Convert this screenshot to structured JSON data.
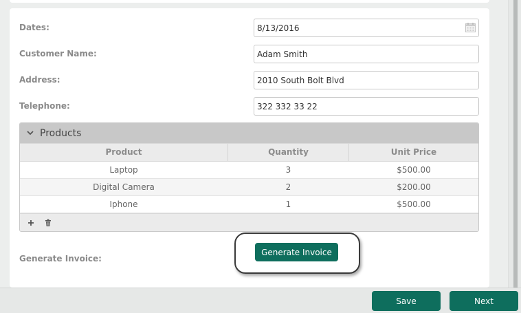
{
  "form": {
    "dates": {
      "label": "Dates:",
      "value": "8/13/2016"
    },
    "customer_name": {
      "label": "Customer Name:",
      "value": "Adam Smith"
    },
    "address": {
      "label": "Address:",
      "value": "2010 South Bolt Blvd"
    },
    "telephone": {
      "label": "Telephone:",
      "value": "322 332 33 22"
    }
  },
  "products": {
    "title": "Products",
    "columns": [
      "Product",
      "Quantity",
      "Unit Price"
    ],
    "rows": [
      [
        "Laptop",
        "3",
        "$500.00"
      ],
      [
        "Digital Camera",
        "2",
        "$200.00"
      ],
      [
        "Iphone",
        "1",
        "$500.00"
      ]
    ]
  },
  "generate_invoice": {
    "label": "Generate Invoice:",
    "button_label": "Generate Invoice"
  },
  "footer": {
    "save_label": "Save",
    "next_label": "Next"
  },
  "icons": {
    "calendar": "calendar-icon",
    "collapse": "chevron-down-icon",
    "add": "plus-icon",
    "delete": "trash-icon"
  },
  "colors": {
    "accent": "#0e6e5d",
    "panel_header": "#c8c8c8"
  }
}
